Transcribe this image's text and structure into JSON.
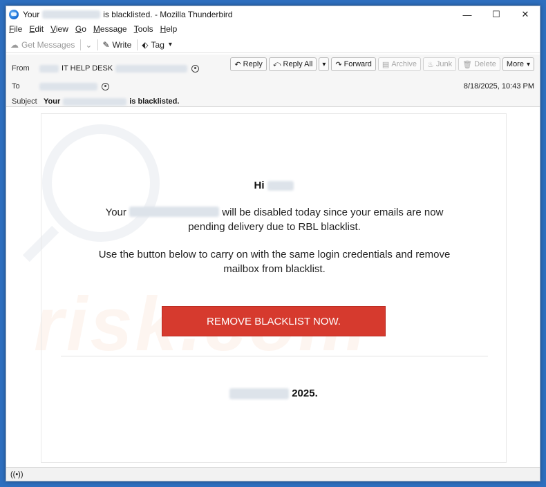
{
  "window": {
    "title_prefix": "Your",
    "title_suffix": "is blacklisted. - Mozilla Thunderbird",
    "controls": {
      "minimize": "—",
      "maximize": "☐",
      "close": "✕"
    }
  },
  "menubar": {
    "items": [
      {
        "u": "F",
        "rest": "ile"
      },
      {
        "u": "E",
        "rest": "dit"
      },
      {
        "u": "V",
        "rest": "iew"
      },
      {
        "u": "G",
        "rest": "o"
      },
      {
        "u": "M",
        "rest": "essage"
      },
      {
        "u": "T",
        "rest": "ools"
      },
      {
        "u": "H",
        "rest": "elp"
      }
    ]
  },
  "toolbar": {
    "get_messages": "Get Messages",
    "write": "Write",
    "tag": "Tag"
  },
  "header": {
    "from_label": "From",
    "from_value": "IT HELP DESK",
    "to_label": "To",
    "subject_label": "Subject",
    "subject_prefix": "Your",
    "subject_suffix": "is blacklisted.",
    "date": "8/18/2025, 10:43 PM",
    "buttons": {
      "reply": "Reply",
      "reply_all": "Reply All",
      "forward": "Forward",
      "archive": "Archive",
      "junk": "Junk",
      "delete": "Delete",
      "more": "More"
    }
  },
  "message": {
    "greeting": "Hi",
    "para1_start": "Your",
    "para1_end": "will be disabled today since your emails are now pending delivery due to RBL blacklist.",
    "para2": "Use the button below to carry on with the same login credentials and remove mailbox from blacklist.",
    "cta": "REMOVE BLACKLIST NOW.",
    "year": "2025."
  },
  "watermark": {
    "text": "risk.com"
  }
}
